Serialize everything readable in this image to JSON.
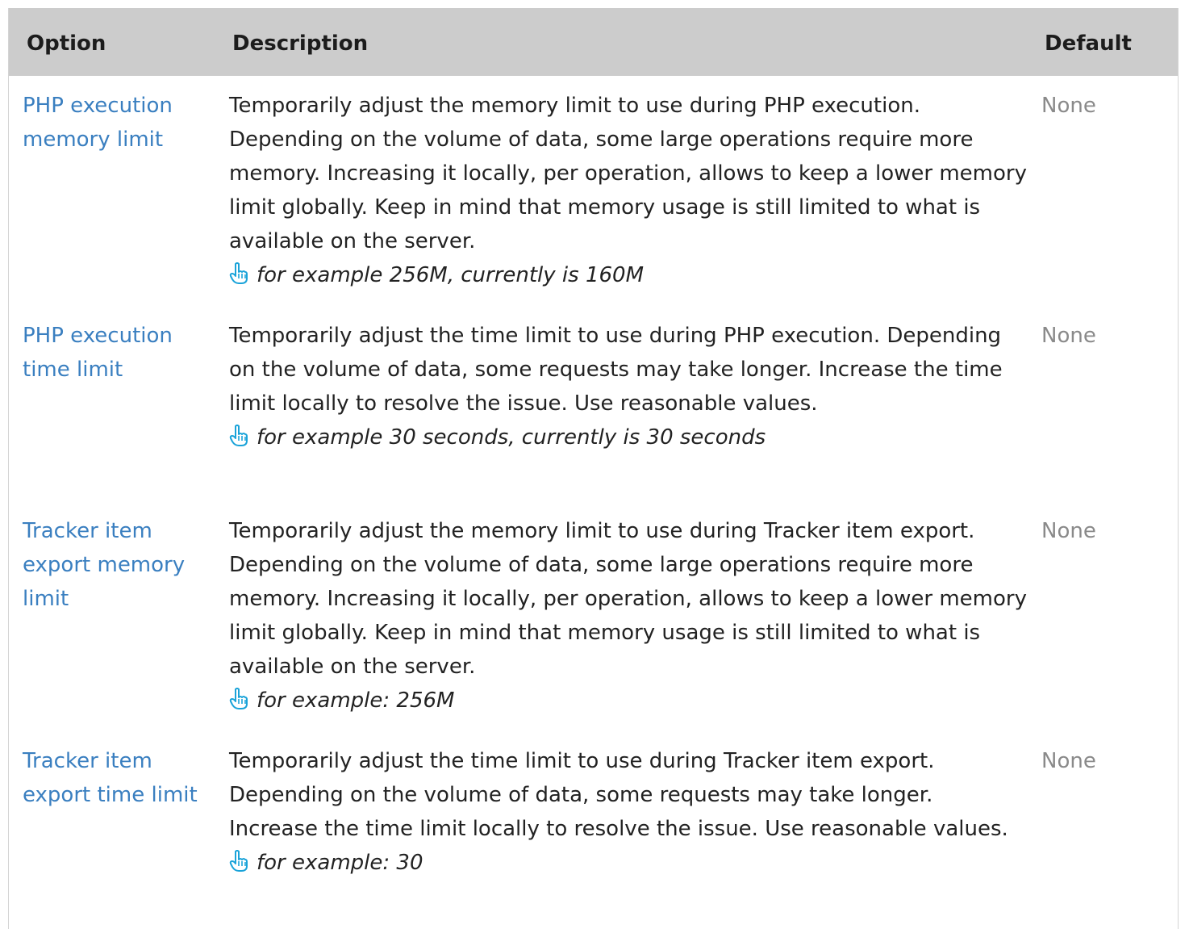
{
  "header": {
    "option": "Option",
    "description": "Description",
    "default": "Default"
  },
  "icons": {
    "example_icon": "pointing-hand-icon",
    "icon_color": "#1aa3d9"
  },
  "colors": {
    "header_bg": "#cccccc",
    "link": "#3a7fc0",
    "default_text": "#8a8a8a"
  },
  "rows": [
    {
      "option": "PHP execution memory limit",
      "description": "Temporarily adjust the memory limit to use during PHP execution. Depending on the volume of data, some large operations require more memory. Increasing it locally, per operation, allows to keep a lower memory limit globally. Keep in mind that memory usage is still limited to what is available on the server.",
      "example": "for example 256M, currently is 160M",
      "default": "None"
    },
    {
      "option": "PHP execution time limit",
      "description": "Temporarily adjust the time limit to use during PHP execution. Depending on the volume of data, some requests may take longer. Increase the time limit locally to resolve the issue. Use reasonable values.",
      "example": "for example 30 seconds, currently is 30 seconds",
      "default": "None"
    },
    {
      "option": "Tracker item export memory limit",
      "description": "Temporarily adjust the memory limit to use during Tracker item export. Depending on the volume of data, some large operations require more memory. Increasing it locally, per operation, allows to keep a lower memory limit globally. Keep in mind that memory usage is still limited to what is available on the server.",
      "example": "for example: 256M",
      "default": "None"
    },
    {
      "option": "Tracker item export time limit",
      "description": "Temporarily adjust the time limit to use during Tracker item export. Depending on the volume of data, some requests may take longer. Increase the time limit locally to resolve the issue. Use reasonable values.",
      "example": "for example: 30",
      "default": "None"
    }
  ]
}
